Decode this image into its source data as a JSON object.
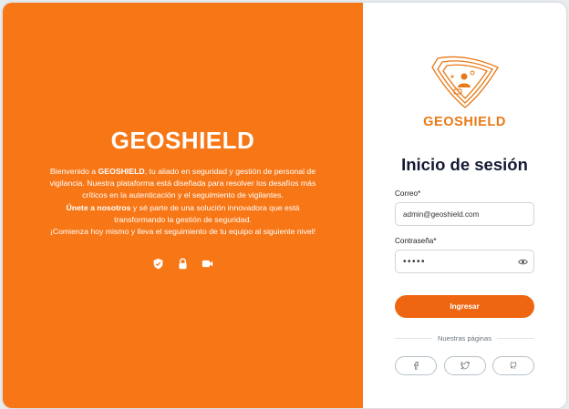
{
  "brand": {
    "name": "GEOSHIELD",
    "logo_text": "GEOSHIELD"
  },
  "welcome": {
    "p1_pre": "Bienvenido a ",
    "p1_bold": "GEOSHIELD",
    "p1_post": ", tu aliado en seguridad y gestión de personal de vigilancia. Nuestra plataforma está diseñada para resolver los desafíos más críticos en la autenticación y el seguimiento de vigilantes.",
    "p2_bold": "Únete a nosotros",
    "p2_post": " y sé parte de una solución innovadora que está transformando la gestión de seguridad.",
    "p3": "¡Comienza hoy mismo y lleva el seguimiento de tu equipo al siguiente nivel!"
  },
  "icons": {
    "left": [
      "shield-check-icon",
      "lock-icon",
      "video-camera-icon"
    ],
    "eye": "eye-icon"
  },
  "login": {
    "title": "Inicio de sesión",
    "email_label": "Correo*",
    "email_value": "admin@geoshield.com",
    "password_label": "Contraseña*",
    "password_value": "•••••",
    "submit_label": "Ingresar",
    "pages_label": "Nuestras páginas"
  },
  "socials": [
    "facebook-icon",
    "twitter-icon",
    "github-icon"
  ],
  "colors": {
    "orange_panel": "#f77716",
    "button": "#ee6612",
    "logo": "#e87a16",
    "title": "#141a33"
  }
}
